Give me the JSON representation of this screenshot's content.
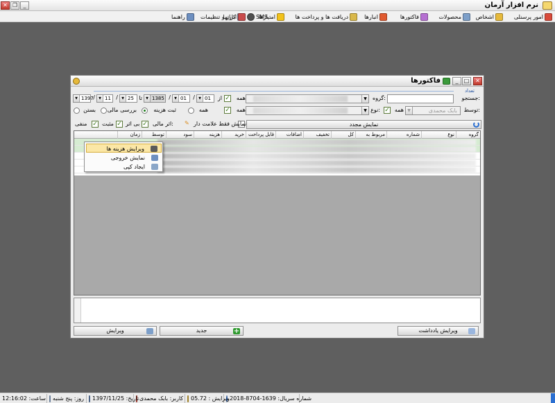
{
  "app": {
    "title": "نرم افزار آرمان",
    "menu": [
      {
        "label": "امور پرسنلی",
        "icon": "people-icon",
        "color": "#d94b3b"
      },
      {
        "label": "اشخاص",
        "icon": "person-icon",
        "color": "#e6b93b"
      },
      {
        "label": "محصولات",
        "icon": "box-icon",
        "color": "#7d9fc9"
      },
      {
        "label": "فاکتورها",
        "icon": "invoice-icon",
        "color": "#b56fd1"
      },
      {
        "label": "انبارها",
        "icon": "warehouse-icon",
        "color": "#e05a2f"
      },
      {
        "label": "دریافت ها و پرداخت ها",
        "icon": "money-icon",
        "color": "#d9b84a"
      },
      {
        "label": "امتیازها",
        "icon": "star-icon",
        "color": "#f2c21b"
      },
      {
        "label": "کارتها",
        "icon": "card-icon",
        "color": "#8aa6c8"
      },
      {
        "label": "SMS",
        "icon": "chat-icon",
        "color": "#4f4f4f"
      },
      {
        "label": "ابزار و تنظیمات",
        "icon": "tools-icon",
        "color": "#c94a4a"
      },
      {
        "label": "راهنما",
        "icon": "help-icon",
        "color": "#6d8fc0"
      }
    ]
  },
  "dialog": {
    "title": "فاکتورها",
    "group_label": "تعداد",
    "filters": {
      "search_label": "جستجو:",
      "search_value": "",
      "group_label": "گروه:",
      "all_label": "همه",
      "type_label": "نوع:",
      "by_label": "توسط:",
      "by_value": "بابک محمدی",
      "from_label": "از",
      "to_label": "تا",
      "from_date": {
        "year": "1385",
        "month": "01",
        "day": "01"
      },
      "to_date": {
        "year": "1397",
        "month": "11",
        "day": "25"
      },
      "radio_options": [
        "ثبت هزینه",
        "بررسی مالی",
        "بستن"
      ],
      "radio_selected": "ثبت هزینه"
    },
    "row3": {
      "financial_effect_label": "اثر مالی:",
      "no_effect": "بی اثر",
      "positive": "مثبت",
      "negative": "منفی",
      "show_marked_only": "نمایش فقط علامت دار",
      "refresh": "نمایش مجدد"
    },
    "grid": {
      "columns": [
        "گروه",
        "نوع",
        "شماره",
        "مربوط به",
        "کل",
        "تخفیف",
        "اضافات",
        "قابل پرداخت",
        "خرید",
        "هزینه",
        "سود",
        "توسط",
        "زمان"
      ]
    },
    "context_menu": [
      {
        "label": "ویرایش هزینه ها",
        "icon": "person-edit-icon"
      },
      {
        "label": "نمایش خروجی",
        "icon": "export-icon"
      },
      {
        "label": "ایجاد کپی",
        "icon": "copy-icon"
      }
    ],
    "buttons": {
      "edit_note": "ویرایش یادداشت",
      "new": "جدید",
      "edit": "ویرایش"
    }
  },
  "statusbar": {
    "serial": "شماره سریال: 1639-8704-2018",
    "version": "ویرایش : 05.72",
    "user": "کاربر: بابک محمدی",
    "date": "تاریخ: 1397/11/25",
    "day": "روز: پنج شنبه",
    "time": "ساعت: 12:16:02"
  },
  "colors": {
    "selected_row": "#d6ecd2",
    "menu_highlight": "#fbe7a6",
    "accent_blue": "#2b6fd1"
  }
}
